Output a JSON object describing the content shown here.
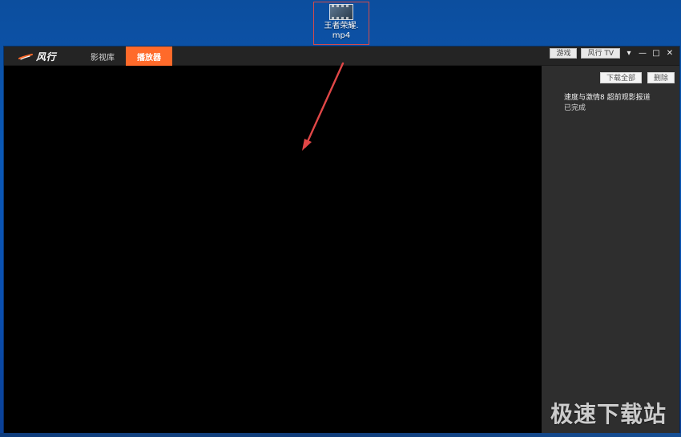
{
  "desktop": {
    "file_icon_caption": "王者荣耀.\nmp4"
  },
  "app": {
    "logo_text": "风行",
    "tabs": [
      {
        "label": "影视库"
      },
      {
        "label": "播放器"
      }
    ],
    "top_buttons": [
      {
        "label": "游戏"
      },
      {
        "label": "风行 TV"
      }
    ],
    "window_controls": [
      {
        "icon": "dropdown-icon",
        "glyph": "▾"
      },
      {
        "icon": "minimize-icon",
        "glyph": "—"
      },
      {
        "icon": "maximize-icon",
        "glyph": "□"
      },
      {
        "icon": "close-icon",
        "glyph": "✕"
      }
    ],
    "sidebar": {
      "actions": [
        {
          "label": "下载全部"
        },
        {
          "label": "删除"
        }
      ],
      "download_item": {
        "title": "速度与激情8 超前观影报道",
        "status": "已完成"
      }
    }
  },
  "watermark": "极速下载站",
  "colors": {
    "accent": "#ff6a2a",
    "annotation": "#e14747"
  }
}
